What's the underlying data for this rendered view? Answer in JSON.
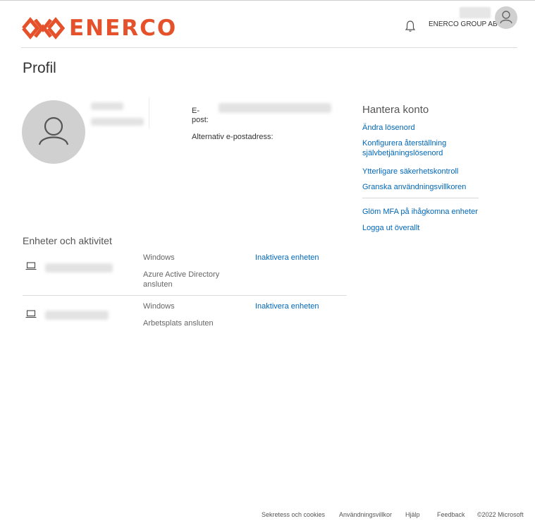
{
  "header": {
    "logo_text": "ENERCO",
    "company": "ENERCO GROUP AB",
    "brand_color": "#e4512a"
  },
  "page_title": "Profil",
  "profile": {
    "email_label": "E-post:",
    "alt_email_label": "Alternativ e-postadress:"
  },
  "manage": {
    "title": "Hantera konto",
    "links": [
      "Ändra lösenord",
      "Konfigurera återställning självbetjäningslösenord",
      "Ytterligare säkerhetskontroll",
      "Granska användningsvillkoren",
      "Glöm MFA på ihågkomna enheter",
      "Logga ut överallt"
    ]
  },
  "devices": {
    "title": "Enheter och aktivitet",
    "rows": [
      {
        "os": "Windows",
        "join_type": "Azure Active Directory ansluten",
        "action": "Inaktivera enheten"
      },
      {
        "os": "Windows",
        "join_type": "Arbetsplats ansluten",
        "action": "Inaktivera enheten"
      }
    ]
  },
  "footer": {
    "privacy": "Sekretess och cookies",
    "terms": "Användningsvillkor",
    "help": "Hjälp",
    "feedback": "Feedback",
    "copyright": "©2022 Microsoft"
  },
  "colors": {
    "link": "#0067b8",
    "text": "#333333",
    "muted": "#666666"
  }
}
